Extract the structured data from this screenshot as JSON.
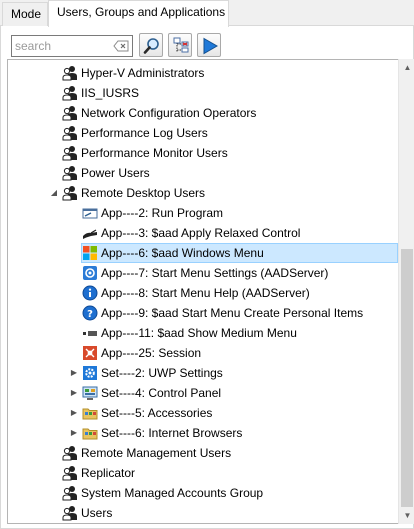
{
  "tabs": [
    {
      "label": "Mode"
    },
    {
      "label": "Users, Groups and Applications"
    }
  ],
  "toolbar": {
    "search_value": "",
    "search_placeholder": "search"
  },
  "tree": {
    "rows": [
      {
        "label": "Hyper-V Administrators",
        "icon": "group-icon",
        "expander": ""
      },
      {
        "label": "IIS_IUSRS",
        "icon": "group-icon",
        "expander": ""
      },
      {
        "label": "Network Configuration Operators",
        "icon": "group-icon",
        "expander": ""
      },
      {
        "label": "Performance Log Users",
        "icon": "group-icon",
        "expander": ""
      },
      {
        "label": "Performance Monitor Users",
        "icon": "group-icon",
        "expander": ""
      },
      {
        "label": "Power Users",
        "icon": "group-icon",
        "expander": ""
      },
      {
        "label": "Remote Desktop Users",
        "icon": "group-icon",
        "expander": "◢"
      },
      {
        "label": "App----2: Run Program",
        "icon": "run-program-icon",
        "expander": ""
      },
      {
        "label": "App----3: $aad Apply Relaxed Control",
        "icon": "relaxed-control-icon",
        "expander": ""
      },
      {
        "label": "App----6: $aad Windows Menu",
        "icon": "windows-logo-icon",
        "expander": "",
        "selected": true
      },
      {
        "label": "App----7: Start Menu Settings (AADServer)",
        "icon": "settings-icon",
        "expander": ""
      },
      {
        "label": "App----8: Start Menu Help (AADServer)",
        "icon": "info-icon",
        "expander": ""
      },
      {
        "label": "App----9: $aad Start Menu Create Personal Items",
        "icon": "question-icon",
        "expander": ""
      },
      {
        "label": "App----11: $aad Show Medium Menu",
        "icon": "medium-menu-icon",
        "expander": ""
      },
      {
        "label": "App----25: Session",
        "icon": "session-icon",
        "expander": ""
      },
      {
        "label": "Set----2: UWP Settings",
        "icon": "gear-icon",
        "expander": "▶"
      },
      {
        "label": "Set----4: Control Panel",
        "icon": "control-panel-icon",
        "expander": "▶"
      },
      {
        "label": "Set----5: Accessories",
        "icon": "folder-icon",
        "expander": "▶"
      },
      {
        "label": "Set----6: Internet Browsers",
        "icon": "folder-icon",
        "expander": "▶"
      },
      {
        "label": "Remote Management Users",
        "icon": "group-icon",
        "expander": ""
      },
      {
        "label": "Replicator",
        "icon": "group-icon",
        "expander": ""
      },
      {
        "label": "System Managed Accounts Group",
        "icon": "group-icon",
        "expander": ""
      },
      {
        "label": "Users",
        "icon": "group-icon",
        "expander": ""
      }
    ]
  },
  "colors": {
    "selection_bg": "#cce8ff",
    "selection_border": "#99d1ff",
    "accent_blue": "#1e78d8"
  }
}
